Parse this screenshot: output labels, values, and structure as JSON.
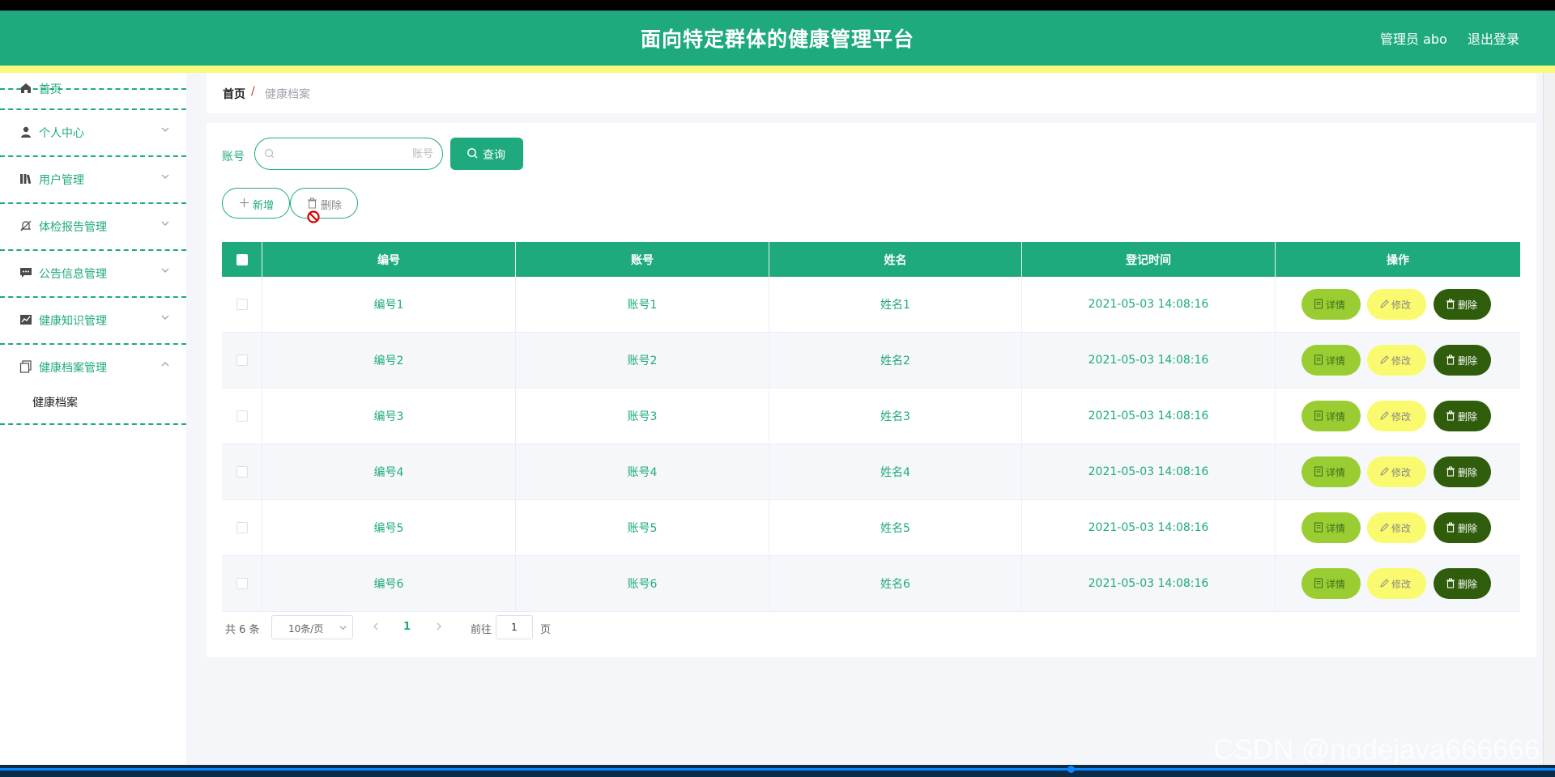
{
  "header": {
    "title": "面向特定群体的健康管理平台",
    "user_label": "管理员 abo",
    "logout_label": "退出登录"
  },
  "colors": {
    "primary": "#1eaa7e",
    "accent_yellow": "#f9f97b",
    "detail_button": "#9acd32",
    "edit_button": "#fafa6e",
    "delete_button": "#2f5d0c"
  },
  "sidebar": {
    "items": [
      {
        "label": "首页",
        "icon": "home-icon"
      },
      {
        "label": "个人中心",
        "icon": "user-icon"
      },
      {
        "label": "用户管理",
        "icon": "library-icon"
      },
      {
        "label": "体检报告管理",
        "icon": "bell-off-icon"
      },
      {
        "label": "公告信息管理",
        "icon": "chat-icon"
      },
      {
        "label": "健康知识管理",
        "icon": "chart-icon"
      },
      {
        "label": "健康档案管理",
        "icon": "copy-document-icon"
      }
    ],
    "sub_item": "健康档案"
  },
  "breadcrumb": {
    "home": "首页",
    "separator": "/",
    "current": "健康档案"
  },
  "search": {
    "label": "账号",
    "placeholder": "账号",
    "value": "",
    "button_label": "查询"
  },
  "actions": {
    "add_label": "新增",
    "delete_label": "删除"
  },
  "table": {
    "columns": [
      "编号",
      "账号",
      "姓名",
      "登记时间",
      "操作"
    ],
    "rows": [
      {
        "id": "编号1",
        "account": "账号1",
        "name": "姓名1",
        "time": "2021-05-03 14:08:16"
      },
      {
        "id": "编号2",
        "account": "账号2",
        "name": "姓名2",
        "time": "2021-05-03 14:08:16"
      },
      {
        "id": "编号3",
        "account": "账号3",
        "name": "姓名3",
        "time": "2021-05-03 14:08:16"
      },
      {
        "id": "编号4",
        "account": "账号4",
        "name": "姓名4",
        "time": "2021-05-03 14:08:16"
      },
      {
        "id": "编号5",
        "account": "账号5",
        "name": "姓名5",
        "time": "2021-05-03 14:08:16"
      },
      {
        "id": "编号6",
        "account": "账号6",
        "name": "姓名6",
        "time": "2021-05-03 14:08:16"
      }
    ],
    "row_actions": {
      "detail": "详情",
      "edit": "修改",
      "delete": "删除"
    }
  },
  "pagination": {
    "total": "共 6 条",
    "page_size": "10条/页",
    "current_page": "1",
    "goto_label": "前往",
    "goto_value": "1",
    "page_suffix": "页"
  },
  "watermark": "CSDN @nodejava666666"
}
